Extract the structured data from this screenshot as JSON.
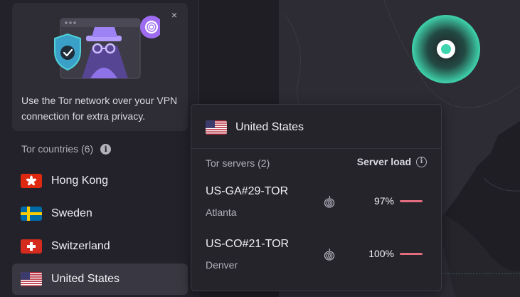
{
  "promo": {
    "text": "Use the Tor network over your VPN connection for extra privacy.",
    "close_label": "×"
  },
  "tor_countries": {
    "heading": "Tor countries (6)",
    "info_glyph": "i",
    "items": [
      {
        "label": "Hong Kong",
        "flag": "hong-kong-flag"
      },
      {
        "label": "Sweden",
        "flag": "sweden-flag"
      },
      {
        "label": "Switzerland",
        "flag": "switzerland-flag"
      },
      {
        "label": "United States",
        "flag": "united-states-flag",
        "active": true
      }
    ]
  },
  "popover": {
    "country": "United States",
    "servers_label": "Tor servers (2)",
    "load_label": "Server load",
    "info_glyph": "i",
    "servers": [
      {
        "name": "US-GA#29-TOR",
        "city": "Atlanta",
        "load": "97%",
        "load_color": "#e26d7f"
      },
      {
        "name": "US-CO#21-TOR",
        "city": "Denver",
        "load": "100%",
        "load_color": "#e26d7f"
      }
    ]
  },
  "map": {
    "connection_pin_color": "#3fd5ae"
  }
}
